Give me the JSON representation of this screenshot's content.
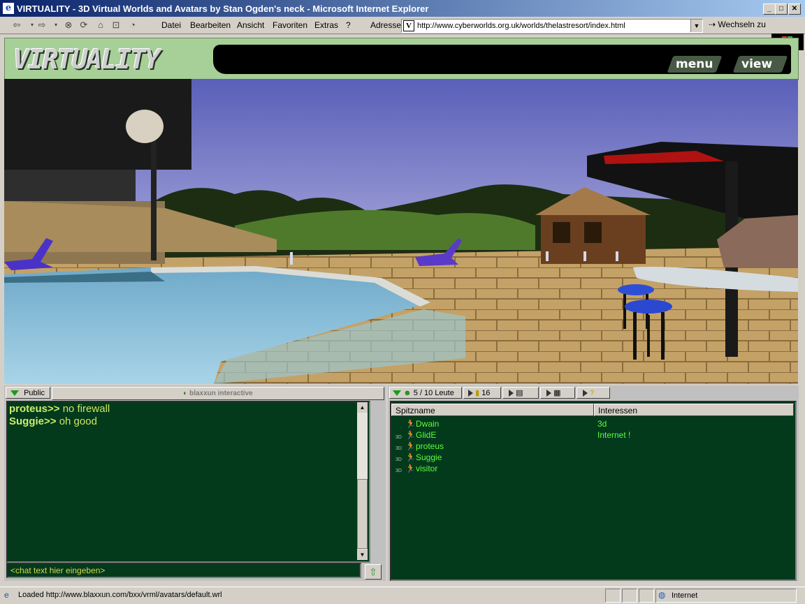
{
  "window": {
    "title": "VIRTUALITY - 3D Virtual Worlds and Avatars by Stan Ogden's neck - Microsoft Internet Explorer"
  },
  "menubar": {
    "items": [
      {
        "label": "Datei"
      },
      {
        "label": "Bearbeiten"
      },
      {
        "label": "Ansicht"
      },
      {
        "label": "Favoriten"
      },
      {
        "label": "Extras"
      },
      {
        "label": "?"
      }
    ]
  },
  "address": {
    "label": "Adresse",
    "url": "http://www.cyberworlds.org.uk/worlds/thelastresort/index.html",
    "go_label": "Wechseln zu"
  },
  "header": {
    "logo_text": "VIRTUALITY",
    "menu_label": "menu",
    "view_label": "view"
  },
  "chat": {
    "tab_label": "Public",
    "brand": "blaxxun interactive",
    "messages": [
      {
        "nick": "proteus>>",
        "text": "no firewall"
      },
      {
        "nick": "Suggie>>",
        "text": "oh good"
      }
    ],
    "input_value": "<chat text hier eingeben>"
  },
  "people": {
    "count_label": "5 / 10 Leute",
    "count2": "16",
    "col_nick": "Spitzname",
    "col_interests": "Interessen",
    "users": [
      {
        "name": "Dwain",
        "interest": "3d",
        "is3d": ""
      },
      {
        "name": "GlidE",
        "interest": "Internet !",
        "is3d": "3D"
      },
      {
        "name": "proteus",
        "interest": "",
        "is3d": "3D"
      },
      {
        "name": "Suggie",
        "interest": "",
        "is3d": "3D"
      },
      {
        "name": "visitor",
        "interest": "",
        "is3d": "3D"
      }
    ]
  },
  "statusbar": {
    "text": "Loaded http://www.blaxxun.com/bxx/vrml/avatars/default.wrl",
    "zone": "Internet"
  }
}
